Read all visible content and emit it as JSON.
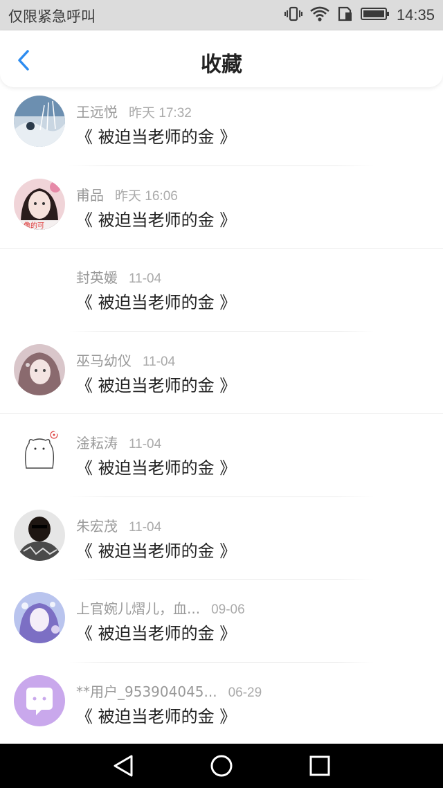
{
  "status_bar": {
    "left_text": "仅限紧急呼叫",
    "time": "14:35",
    "icons": [
      "vibrate-icon",
      "wifi-icon",
      "sim-icon",
      "battery-icon"
    ]
  },
  "header": {
    "title": "收藏",
    "back_icon": "chevron-left-icon",
    "accent": "#2d8cf0"
  },
  "items": [
    {
      "name": "王远悦",
      "date": "昨天 17:32",
      "title": "《 被迫当老师的金 》",
      "avatar": "landscape-avatar"
    },
    {
      "name": "甫品",
      "date": "昨天 16:06",
      "title": "《 被迫当老师的金 》",
      "avatar": "girl-avatar"
    },
    {
      "name": "封英媛",
      "date": "11-04",
      "title": "《 被迫当老师的金 》",
      "avatar": "blank-avatar"
    },
    {
      "name": "巫马幼仪",
      "date": "11-04",
      "title": "《 被迫当老师的金 》",
      "avatar": "girl-avatar-2"
    },
    {
      "name": "淦耘涛",
      "date": "11-04",
      "title": "《 被迫当老师的金 》",
      "avatar": "bear-avatar"
    },
    {
      "name": "朱宏茂",
      "date": "11-04",
      "title": "《 被迫当老师的金 》",
      "avatar": "man-avatar"
    },
    {
      "name": "上官婉儿熠儿，血...",
      "date": "09-06",
      "title": "《 被迫当老师的金 》",
      "avatar": "anime-avatar"
    },
    {
      "name": "**用户_953904045...",
      "date": "06-29",
      "title": "《 被迫当老师的金 》",
      "avatar": "chat-bubble-avatar"
    }
  ],
  "system_nav": {
    "buttons": [
      "back-triangle-icon",
      "home-circle-icon",
      "recents-square-icon"
    ]
  }
}
